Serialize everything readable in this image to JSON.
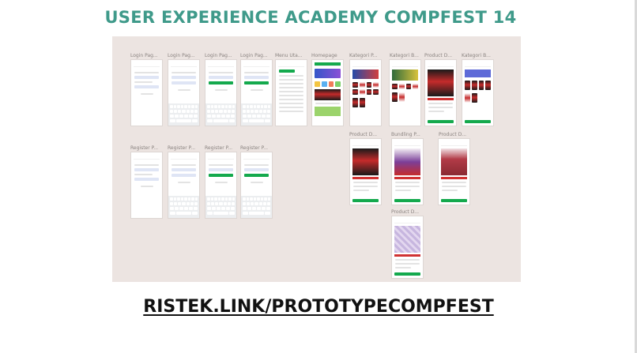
{
  "header": {
    "title": "USER EXPERIENCE ACADEMY COMPFEST 14"
  },
  "frames": {
    "login_1": "Login Pag...",
    "login_2": "Login Pag...",
    "login_3": "Login Pag...",
    "login_4": "Login Pag...",
    "menu_utama": "Menu Uta...",
    "homepage": "Homepage",
    "kategori_1": "Kategori P...",
    "kategori_2": "Kategori B...",
    "product_1": "Product D...",
    "kategori_3": "Kategori B...",
    "register_1": "Register P...",
    "register_2": "Register P...",
    "register_3": "Register P...",
    "register_4": "Register P...",
    "product_2": "Product D...",
    "bundling": "Bundling P...",
    "product_3": "Product D...",
    "product_4": "Product D..."
  },
  "footer": {
    "link": "RISTEK.LINK/PROTOTYPECOMPFEST"
  },
  "colors": {
    "title": "#3f9a8a",
    "canvas": "#ece4e1",
    "accent_green": "#14a94d",
    "accent_red": "#c52b2b"
  }
}
